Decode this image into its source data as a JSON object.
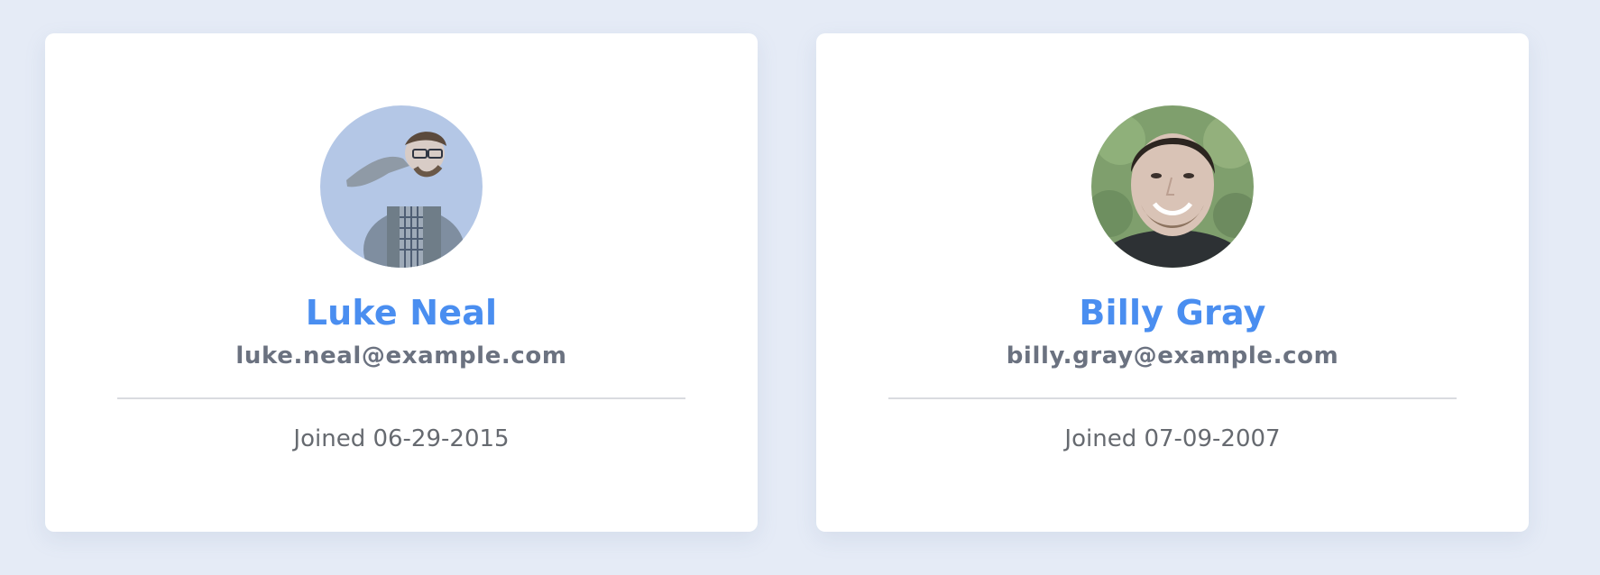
{
  "profiles": [
    {
      "name": "Luke Neal",
      "email": "luke.neal@example.com",
      "joined": "Joined 06-29-2015",
      "avatar_icon": "user-photo-icon"
    },
    {
      "name": "Billy Gray",
      "email": "billy.gray@example.com",
      "joined": "Joined 07-09-2007",
      "avatar_icon": "user-photo-icon"
    }
  ],
  "colors": {
    "background": "#e5ebf6",
    "card": "#ffffff",
    "name": "#4a8ef0",
    "email": "#6b7280",
    "joined": "#666a70",
    "divider": "#d9dbe0"
  }
}
